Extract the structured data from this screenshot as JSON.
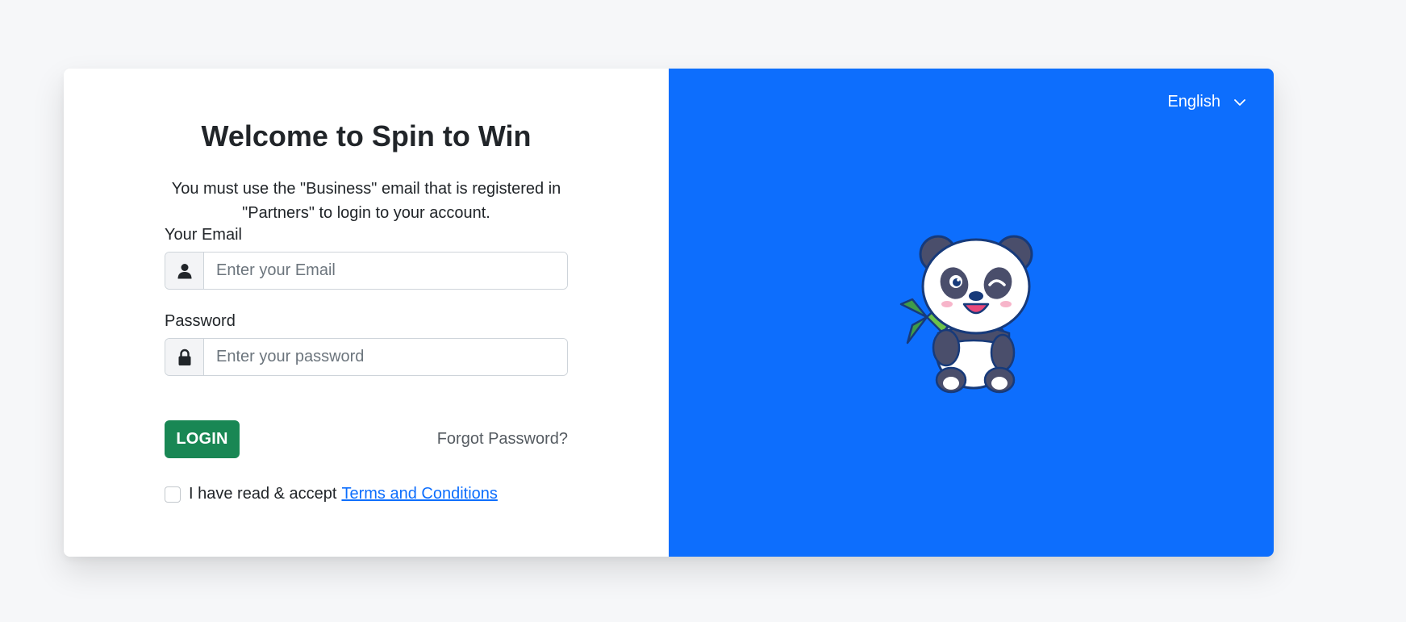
{
  "login": {
    "title": "Welcome to Spin to Win",
    "subtitle": "You must use the \"Business\" email that is registered in \"Partners\" to login to your account.",
    "email_label": "Your Email",
    "email_placeholder": "Enter your Email",
    "email_value": "",
    "password_label": "Password",
    "password_placeholder": "Enter your password",
    "password_value": "",
    "login_button": "LOGIN",
    "forgot_password": "Forgot Password?",
    "terms_text": "I have read & accept",
    "terms_link": "Terms and Conditions",
    "terms_checked": false
  },
  "language": {
    "selected": "English"
  },
  "icons": {
    "email": "user-icon",
    "password": "lock-icon",
    "language": "chevron-down-icon",
    "mascot": "panda-mascot"
  },
  "colors": {
    "page_background": "#f6f7f9",
    "brand_blue": "#0d6efd",
    "login_green": "#198754",
    "link_blue": "#0d6efd"
  }
}
